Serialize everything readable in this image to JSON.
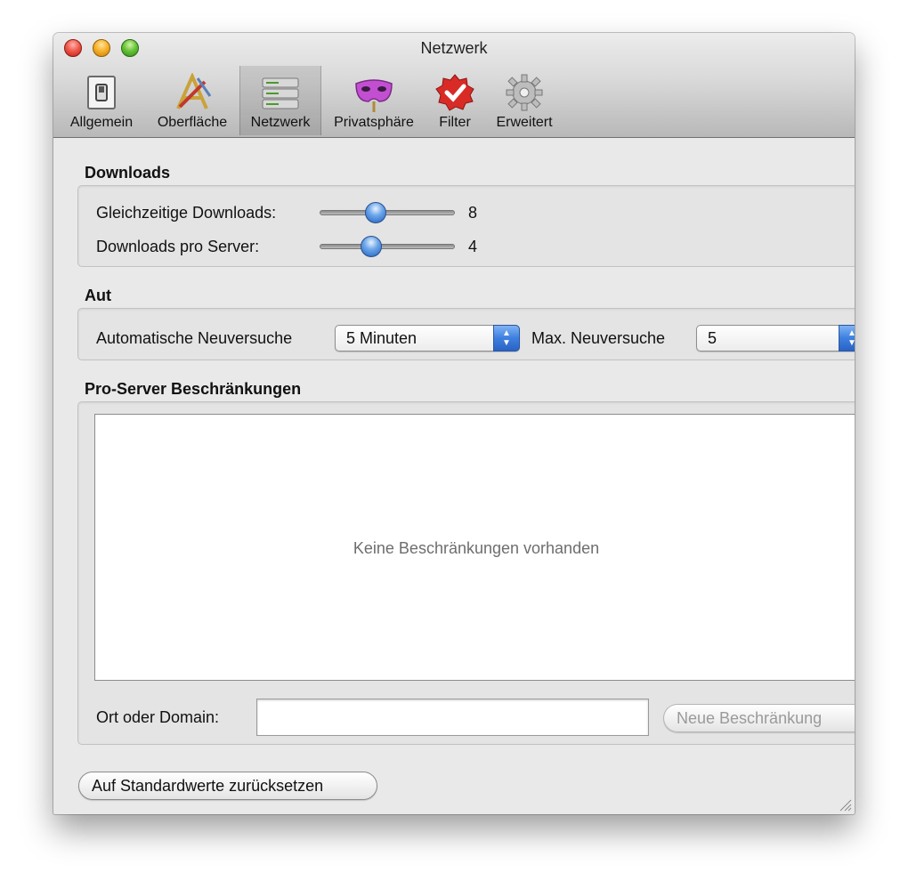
{
  "window": {
    "title": "Netzwerk"
  },
  "toolbar": {
    "items": [
      {
        "label": "Allgemein",
        "icon": "switch-icon",
        "selected": false
      },
      {
        "label": "Oberfläche",
        "icon": "drawing-tools-icon",
        "selected": false
      },
      {
        "label": "Netzwerk",
        "icon": "server-icon",
        "selected": true
      },
      {
        "label": "Privatsphäre",
        "icon": "mask-icon",
        "selected": false
      },
      {
        "label": "Filter",
        "icon": "badge-check-icon",
        "selected": false
      },
      {
        "label": "Erweitert",
        "icon": "gear-icon",
        "selected": false
      }
    ]
  },
  "downloads": {
    "heading": "Downloads",
    "concurrent": {
      "label": "Gleichzeitige Downloads:",
      "value": "8",
      "level": 0.4
    },
    "per_server": {
      "label": "Downloads pro Server:",
      "value": "4",
      "level": 0.36
    }
  },
  "retry": {
    "heading": "Aut",
    "auto_label": "Automatische Neuversuche",
    "auto_value": "5 Minuten",
    "max_label": "Max. Neuversuche",
    "max_value": "5"
  },
  "restrictions": {
    "heading": "Pro-Server Beschränkungen",
    "empty_text": "Keine Beschränkungen vorhanden",
    "domain_label": "Ort oder Domain:",
    "domain_value": "",
    "new_button": "Neue Beschränkung"
  },
  "footer": {
    "reset_button": "Auf Standardwerte zurücksetzen"
  },
  "colors": {
    "accent": "#3d7fe0",
    "close": "#f05a4c",
    "minimize": "#f7b32a",
    "zoom": "#69c43a"
  }
}
